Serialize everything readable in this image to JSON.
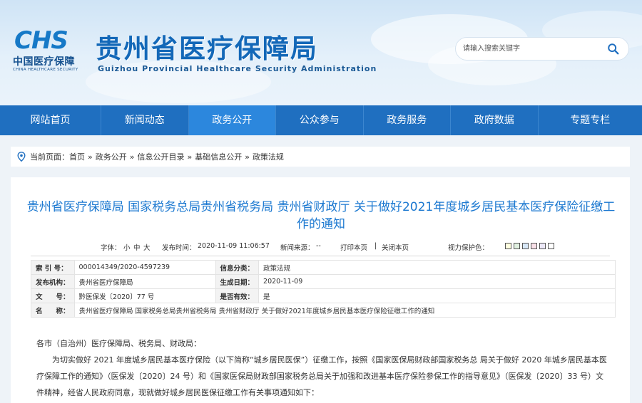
{
  "header": {
    "logo_mark": "CHS",
    "logo_cn": "中国医疗保障",
    "logo_en": "CHINA HEALTHCARE SECURITY",
    "site_title": "贵州省医疗保障局",
    "site_subtitle": "Guizhou Provincial Healthcare Security Administration",
    "search_placeholder": "请输入搜索关键字",
    "search_icon": "search-icon"
  },
  "nav": {
    "items": [
      "网站首页",
      "新闻动态",
      "政务公开",
      "公众参与",
      "政务服务",
      "政府数据",
      "专题专栏"
    ],
    "active_index": 2
  },
  "breadcrumb": {
    "prefix": "当前页面：",
    "items": [
      "首页",
      "政务公开",
      "信息公开目录",
      "基础信息公开",
      "政策法规"
    ],
    "separator": "»"
  },
  "article": {
    "title": "贵州省医疗保障局 国家税务总局贵州省税务局 贵州省财政厅 关于做好2021年度城乡居民基本医疗保险征缴工作的通知",
    "meta": {
      "font_label": "字体：",
      "font_sizes": [
        "小",
        "中",
        "大"
      ],
      "publish_label": "发布时间：",
      "publish_time": "2020-11-09 11:06:57",
      "source_label": "新闻来源：",
      "source": "--",
      "print": "打印本页",
      "divider": "|",
      "close": "关闭本页",
      "vision_label": "视力保护色：",
      "vision_colors": [
        "#ffffe0",
        "#e0f0e0",
        "#d8e8f8",
        "#f8e0e8",
        "#ece8f8",
        "#ffffff"
      ]
    },
    "info": {
      "index_label": "索 引 号：",
      "index": "000014349/2020-4597239",
      "category_label": "信息分类：",
      "category": "政策法规",
      "publisher_label": "发布机构：",
      "publisher": "贵州省医疗保障局",
      "date_label": "生成日期：",
      "date": "2020-11-09",
      "doc_no_label": "文　　号：",
      "doc_no": "黔医保发〔2020〕77 号",
      "valid_label": "是否有效：",
      "valid": "是",
      "name_label": "名　　称：",
      "name": "贵州省医疗保障局 国家税务总局贵州省税务局 贵州省财政厅 关于做好2021年度城乡居民基本医疗保险征缴工作的通知"
    },
    "salutation": "各市（自治州）医疗保障局、税务局、财政局：",
    "paragraph": "为切实做好 2021 年度城乡居民基本医疗保险（以下简称“城乡居民医保”）征缴工作，按照《国家医保局财政部国家税务总 局关于做好 2020 年城乡居民基本医疗保障工作的通知》（医保发〔2020〕24 号）和《国家医保局财政部国家税务总局关于加强和改进基本医疗保险参保工作的指导意见》（医保发〔2020〕33 号）文件精神，经省人民政府同意，现就做好城乡居民医保征缴工作有关事项通知如下："
  }
}
